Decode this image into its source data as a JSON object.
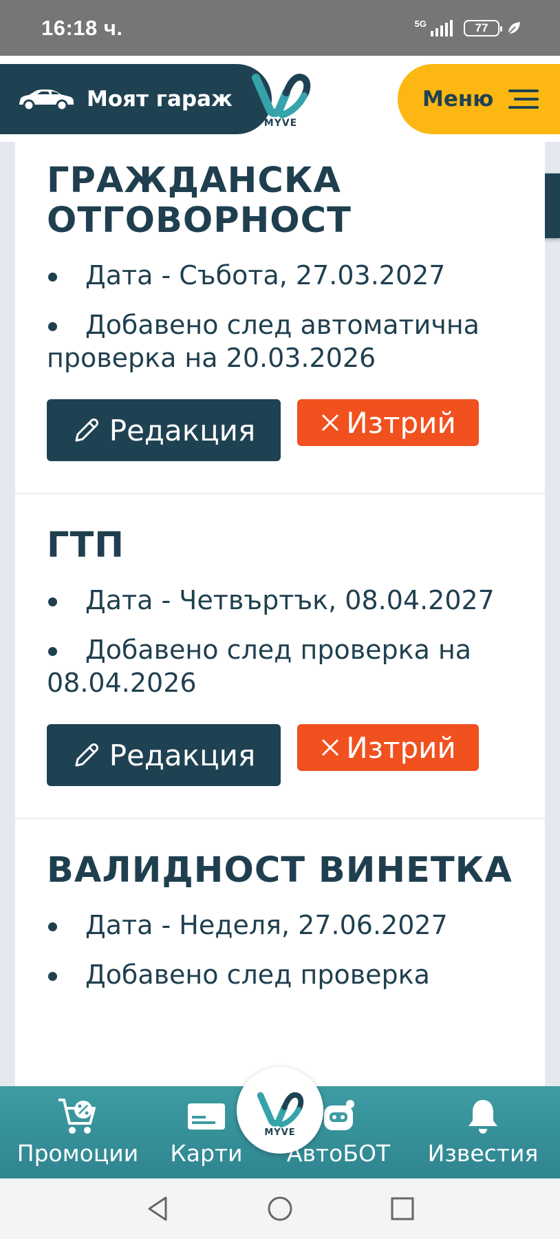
{
  "status_bar": {
    "time": "16:18 ч.",
    "network": "5G",
    "battery": "77"
  },
  "header": {
    "garage_label": "Моят гараж",
    "logo_text": "MYVE",
    "menu_label": "Меню"
  },
  "entries": [
    {
      "title": "ГРАЖДАНСКА ОТГОВОРНОСТ",
      "date": "Дата - Събота, 27.03.2027",
      "added": "Добавено след автоматична проверка на 20.03.2026",
      "edit_label": "Редакция",
      "delete_label": "Изтрий"
    },
    {
      "title": "ГТП",
      "date": "Дата - Четвъртък, 08.04.2027",
      "added": "Добавено след проверка на 08.04.2026",
      "edit_label": "Редакция",
      "delete_label": "Изтрий"
    },
    {
      "title": "ВАЛИДНОСТ ВИНЕТКА",
      "date": "Дата - Неделя, 27.06.2027",
      "added": "Добавено след проверка"
    }
  ],
  "bottom_nav": {
    "items": [
      {
        "label": "Промоции",
        "icon": "cart-percent-icon"
      },
      {
        "label": "Карти",
        "icon": "card-icon"
      },
      {
        "label": "АвтоБОТ",
        "icon": "robot-icon"
      },
      {
        "label": "Известия",
        "icon": "bell-icon"
      }
    ],
    "center_logo_text": "MYVE"
  },
  "colors": {
    "primary": "#1f4252",
    "accent": "#fcb713",
    "danger": "#f0511f",
    "teal": "#3e9ca2"
  }
}
